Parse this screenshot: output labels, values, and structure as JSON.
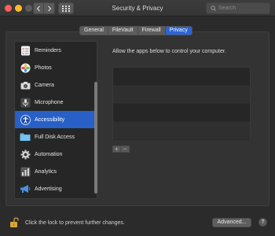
{
  "window": {
    "title": "Security & Privacy",
    "search_placeholder": "Search"
  },
  "tabs": [
    {
      "label": "General",
      "active": false
    },
    {
      "label": "FileVault",
      "active": false
    },
    {
      "label": "Firewall",
      "active": false
    },
    {
      "label": "Privacy",
      "active": true
    }
  ],
  "sidebar": {
    "items": [
      {
        "label": "Reminders",
        "icon": "reminders-icon"
      },
      {
        "label": "Photos",
        "icon": "photos-icon"
      },
      {
        "label": "Camera",
        "icon": "camera-icon"
      },
      {
        "label": "Microphone",
        "icon": "microphone-icon"
      },
      {
        "label": "Accessibility",
        "icon": "accessibility-icon",
        "selected": true
      },
      {
        "label": "Full Disk Access",
        "icon": "folder-icon"
      },
      {
        "label": "Automation",
        "icon": "gear-icon"
      },
      {
        "label": "Analytics",
        "icon": "analytics-icon"
      },
      {
        "label": "Advertising",
        "icon": "megaphone-icon"
      }
    ]
  },
  "content": {
    "description": "Allow the apps below to control your computer.",
    "add_label": "+",
    "remove_label": "−"
  },
  "footer": {
    "lock_text": "Click the lock to prevent further changes.",
    "advanced_label": "Advanced...",
    "help_label": "?"
  },
  "colors": {
    "accent": "#2c64d4",
    "selection": "#2860c8",
    "background": "#2b2b2b"
  }
}
